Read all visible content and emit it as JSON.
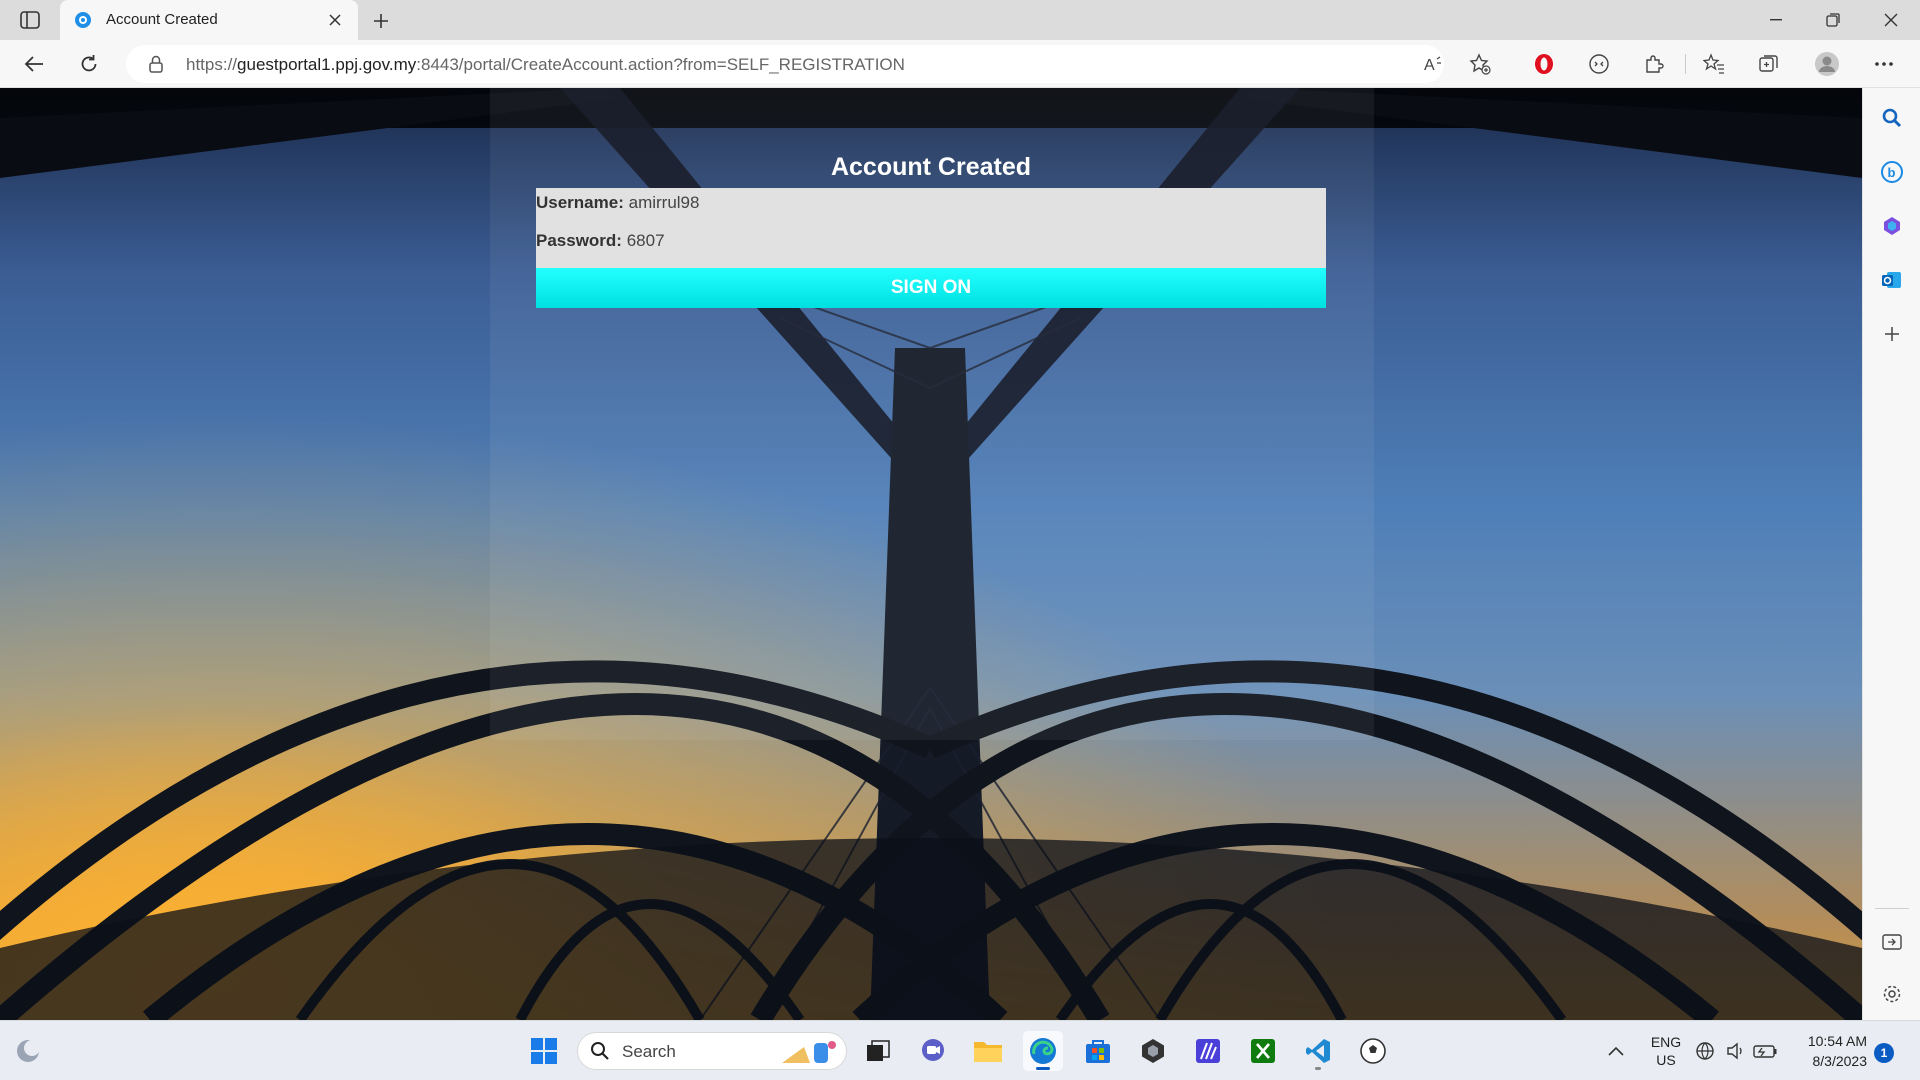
{
  "browser": {
    "tab_title": "Account Created",
    "url_prefix": "https://",
    "url_host": "guestportal1.ppj.gov.my",
    "url_rest": ":8443/portal/CreateAccount.action?from=SELF_REGISTRATION"
  },
  "page": {
    "title": "Account Created",
    "username_label": "Username:",
    "username_value": "amirrul98",
    "password_label": "Password:",
    "password_value": "6807",
    "sign_on_label": "SIGN ON"
  },
  "taskbar": {
    "search_placeholder": "Search",
    "lang_top": "ENG",
    "lang_bottom": "US",
    "time": "10:54 AM",
    "date": "8/3/2023",
    "notification_count": "1"
  },
  "colors": {
    "signon_button": "#00efef",
    "cred_box": "#e1e1e1"
  },
  "icons": [
    "sidebar-toggle-icon",
    "edge-favicon",
    "close-icon",
    "plus-icon",
    "minimize-icon",
    "restore-icon",
    "back-icon",
    "refresh-icon",
    "lock-icon",
    "read-aloud-icon",
    "add-favorite-icon",
    "opera-icon",
    "extension-icon",
    "puzzle-icon",
    "favorites-icon",
    "collections-icon",
    "profile-icon",
    "more-icon",
    "search-icon",
    "bing-icon",
    "copilot-icon",
    "outlook-icon",
    "windows-icon"
  ]
}
